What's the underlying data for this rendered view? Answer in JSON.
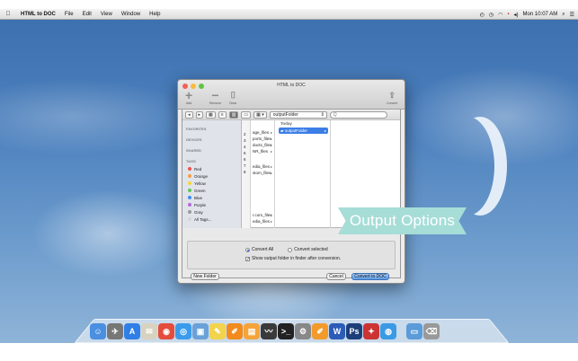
{
  "menubar": {
    "apple": "",
    "app_name": "HTML to DOC",
    "menus": [
      "File",
      "Edit",
      "View",
      "Window",
      "Help"
    ],
    "clock": "Mon 10:07 AM"
  },
  "window": {
    "title": "HTML to DOC",
    "toolbar": [
      {
        "icon": "plus-icon",
        "label": "Add"
      },
      {
        "icon": "minus-icon",
        "label": "Remove"
      },
      {
        "icon": "trash-icon",
        "label": "Clear"
      },
      {
        "icon": "share-icon",
        "label": "Convert"
      }
    ]
  },
  "dialog": {
    "nav": {
      "back": "◂",
      "forward": "▸",
      "view_icon": "▥",
      "arrange": "▦ ▾",
      "folder": "outputFolder",
      "search_placeholder": "Q"
    },
    "sidebar": {
      "favorites": "FAVORITES",
      "devices": "DEVICES",
      "shared": "SHARED",
      "tags_header": "TAGS",
      "tags": [
        {
          "label": "Red",
          "color": "#f0524f"
        },
        {
          "label": "Orange",
          "color": "#f5a043"
        },
        {
          "label": "Yellow",
          "color": "#f3d53b"
        },
        {
          "label": "Green",
          "color": "#5fc65a"
        },
        {
          "label": "Blue",
          "color": "#3e8ef0"
        },
        {
          "label": "Purple",
          "color": "#b469d9"
        },
        {
          "label": "Gray",
          "color": "#9a9a9a"
        },
        {
          "label": "All Tags...",
          "color": "#d6d6d6"
        }
      ]
    },
    "col_left": [
      "2",
      "3",
      "4",
      "5",
      "6",
      "7",
      "8"
    ],
    "col_mid_top": [
      "age_files",
      "ports_files",
      "ducts_files",
      "NR_files"
    ],
    "col_mid_mid": [
      "edia_files",
      "stom_files"
    ],
    "col_mid_bot": [
      "r.com_files",
      "edia_files"
    ],
    "col_right": {
      "header": "Today",
      "selected": "outputFolder"
    },
    "options": {
      "convert_all": "Convert All",
      "convert_selected": "Convert selected",
      "show_output": "Show output folder in finder after conversion."
    },
    "buttons": {
      "new_folder": "New Folder",
      "cancel": "Cancel",
      "convert": "Convert to DOC"
    }
  },
  "overlay": {
    "badge": "Output Options"
  },
  "dock": {
    "icons": [
      "finder-icon",
      "rocket-icon",
      "app-store-icon",
      "mail-stamp-icon",
      "chrome-icon",
      "safari-icon",
      "preview-icon",
      "notes-icon",
      "pages-icon",
      "ibooks-icon",
      "activity-monitor-icon",
      "terminal-icon",
      "system-prefs-icon",
      "pages-icon",
      "word-icon",
      "photoshop-icon",
      "photo-icon",
      "globe-icon",
      "folder-icon",
      "trash-icon"
    ]
  }
}
